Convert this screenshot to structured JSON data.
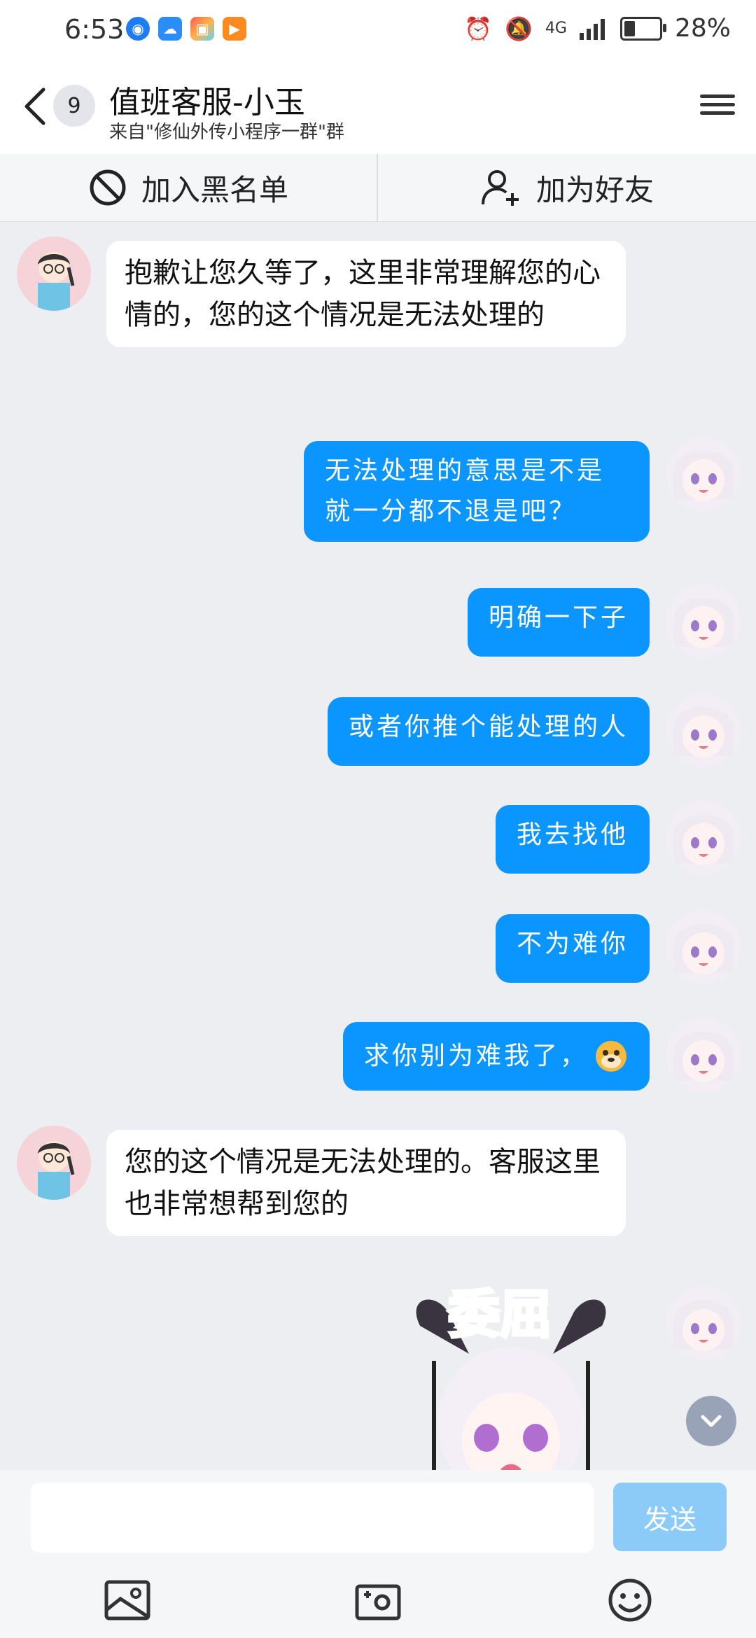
{
  "status_bar": {
    "time": "6:53",
    "network": "4G",
    "battery": "28%",
    "battery_level": 0.28
  },
  "header": {
    "badge_count": "9",
    "title": "值班客服-小玉",
    "subtitle": "来自\"修仙外传小程序一群\"群"
  },
  "action_bar": {
    "blacklist_label": "加入黑名单",
    "add_friend_label": "加为好友"
  },
  "messages": [
    {
      "side": "in",
      "text": "抱歉让您久等了，这里非常理解您的心情的，您的这个情况是无法处理的"
    },
    {
      "side": "out",
      "text": "无法处理的意思是不是就一分都不退是吧？"
    },
    {
      "side": "out",
      "text": "明确一下子"
    },
    {
      "side": "out",
      "text": "或者你推个能处理的人"
    },
    {
      "side": "out",
      "text": "我去找他"
    },
    {
      "side": "out",
      "text": "不为难你"
    },
    {
      "side": "out",
      "text": "求你别为难我了，"
    },
    {
      "side": "in",
      "text": "您的这个情况是无法处理的。客服这里也非常想帮到您的"
    }
  ],
  "sticker": {
    "caption": "委屈"
  },
  "input_bar": {
    "send_label": "发送"
  },
  "colors": {
    "out_bubble": "#0b95ff",
    "send_disabled": "#8ccaf8",
    "background": "#eceef2"
  }
}
